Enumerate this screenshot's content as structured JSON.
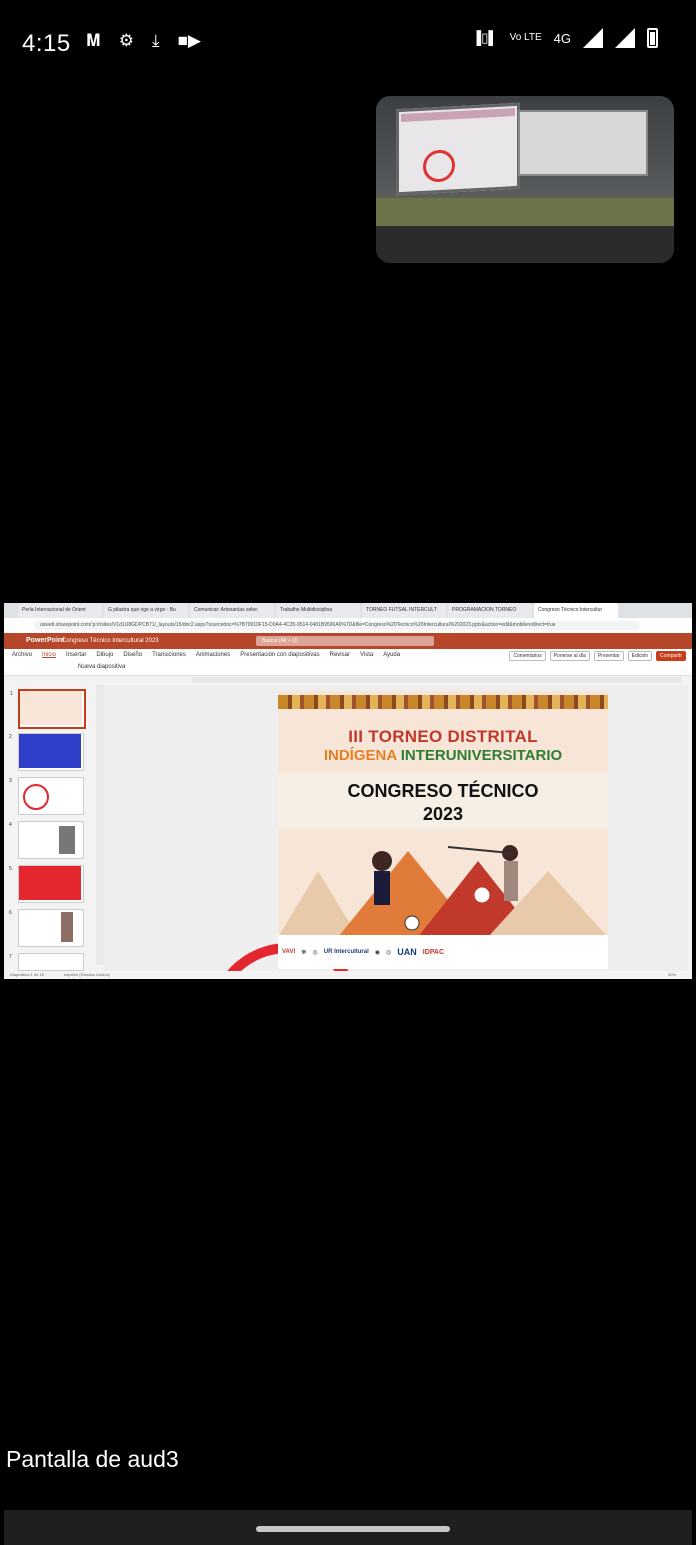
{
  "status_bar": {
    "time": "4:15",
    "network_label": "4G",
    "volte_label": "Vo LTE"
  },
  "browser": {
    "tabs": [
      "Perla Internacional de Orient",
      "G pilastra que rige a virgo - Bu",
      "Comunicar: Artesanías selec",
      "Trabalho Multidisciplina",
      "TORNEO FUTSAL INTERCULT",
      "PROGRAMACION TORNEO",
      "Congreso Técnico Intercultur"
    ],
    "url": "usweb.sharepoint.com/:p:/r/sites/V1d1U8GDPCB71/_layouts/15/doc2.aspx?sourcedoc=%7B70910F15-D0A4-4C35-9514-0481B9596A6%7D&file=Congreso%20Tecnico%20Intercultural%202023.pptx&action=edit&mobileredirect=true"
  },
  "powerpoint": {
    "app_name": "PowerPoint",
    "doc_title": "Congreso Técnico Intercultural 2023",
    "search_placeholder": "Buscar (Alt + Q)",
    "menu": [
      "Archivo",
      "Inicio",
      "Insertar",
      "Dibujo",
      "Diseño",
      "Transiciones",
      "Animaciones",
      "Presentación con diapositivas",
      "Revisar",
      "Vista",
      "Ayuda"
    ],
    "right_buttons": {
      "comments": "Comentarios",
      "catch_up": "Ponerse al día",
      "present": "Presentar",
      "editing": "Edición",
      "share": "Compartir"
    },
    "new_slide": "Nueva diapositiva",
    "thumb_numbers": [
      "1",
      "2",
      "3",
      "4",
      "5",
      "6",
      "7"
    ],
    "status_left": "Diapositiva 1 de 16",
    "status_lang": "español (Estados Unidos)",
    "status_zoom": "50%"
  },
  "slide": {
    "title_line1": "III TORNEO DISTRITAL",
    "title_line2_a": "INDÍGENA",
    "title_line2_b": "INTERUNIVERSITARIO",
    "congreso": "CONGRESO TÉCNICO",
    "year": "2023",
    "logo_ur": "UR Intercultural",
    "logo_uan": "UAN",
    "logo_idpac": "IDPAC"
  },
  "caption": "Pantalla de aud3",
  "colors": {
    "ppt_brand": "#b7472a",
    "title_red": "#c0392b",
    "title_green": "#2e7d32",
    "circle_red": "#e4262e"
  }
}
